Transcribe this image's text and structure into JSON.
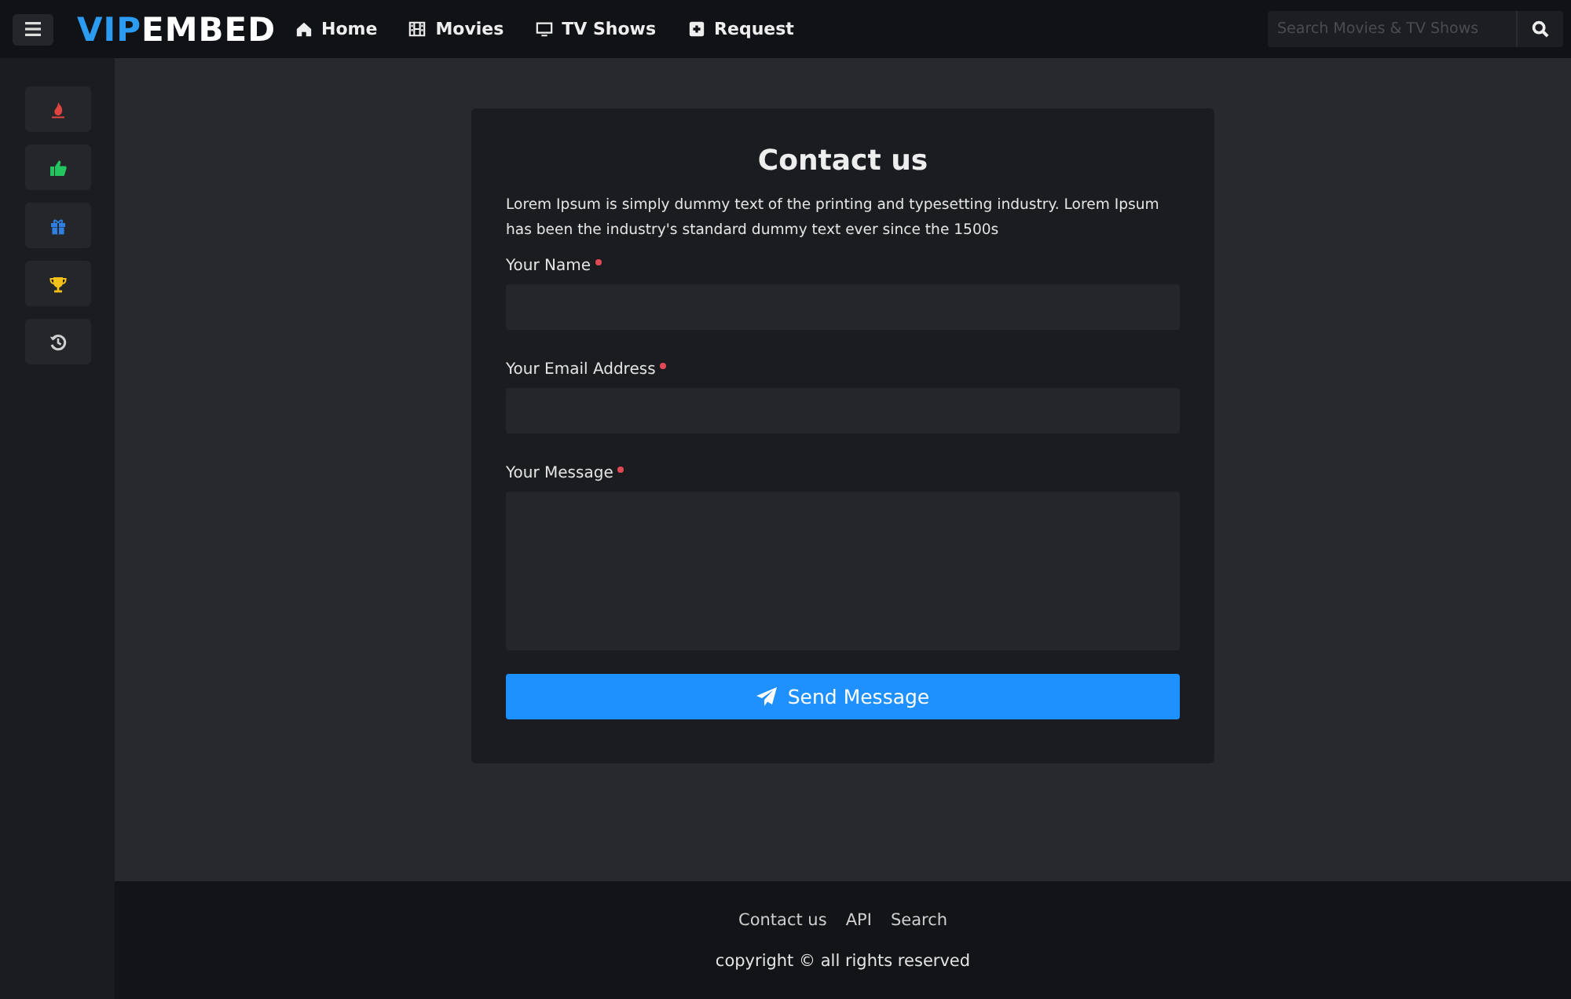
{
  "header": {
    "logo": {
      "accent": "VIP",
      "rest": "EMBED"
    },
    "nav": [
      {
        "label": "Home",
        "kind": "home"
      },
      {
        "label": "Movies",
        "kind": "film"
      },
      {
        "label": "TV Shows",
        "kind": "tv"
      },
      {
        "label": "Request",
        "kind": "plus"
      }
    ],
    "search": {
      "placeholder": "Search Movies & TV Shows"
    }
  },
  "sidebar": {
    "items": [
      {
        "kind": "fire",
        "color": "#e0443f"
      },
      {
        "kind": "thumb",
        "color": "#22c55e"
      },
      {
        "kind": "gift",
        "color": "#2f7fe0"
      },
      {
        "kind": "trophy",
        "color": "#f2c21b"
      },
      {
        "kind": "history",
        "color": "#cfd0d2"
      }
    ]
  },
  "contact": {
    "title": "Contact us",
    "intro": "Lorem Ipsum is simply dummy text of the printing and typesetting industry. Lorem Ipsum has been the industry's standard dummy text ever since the 1500s",
    "fields": [
      {
        "label": "Your Name",
        "required": true,
        "kind": "input"
      },
      {
        "label": "Your Email Address",
        "required": true,
        "kind": "input"
      },
      {
        "label": "Your Message",
        "required": true,
        "kind": "textarea"
      }
    ],
    "submit": "Send Message"
  },
  "footer": {
    "links": [
      "Contact us",
      "API",
      "Search"
    ],
    "copyright": "copyright © all rights reserved"
  }
}
